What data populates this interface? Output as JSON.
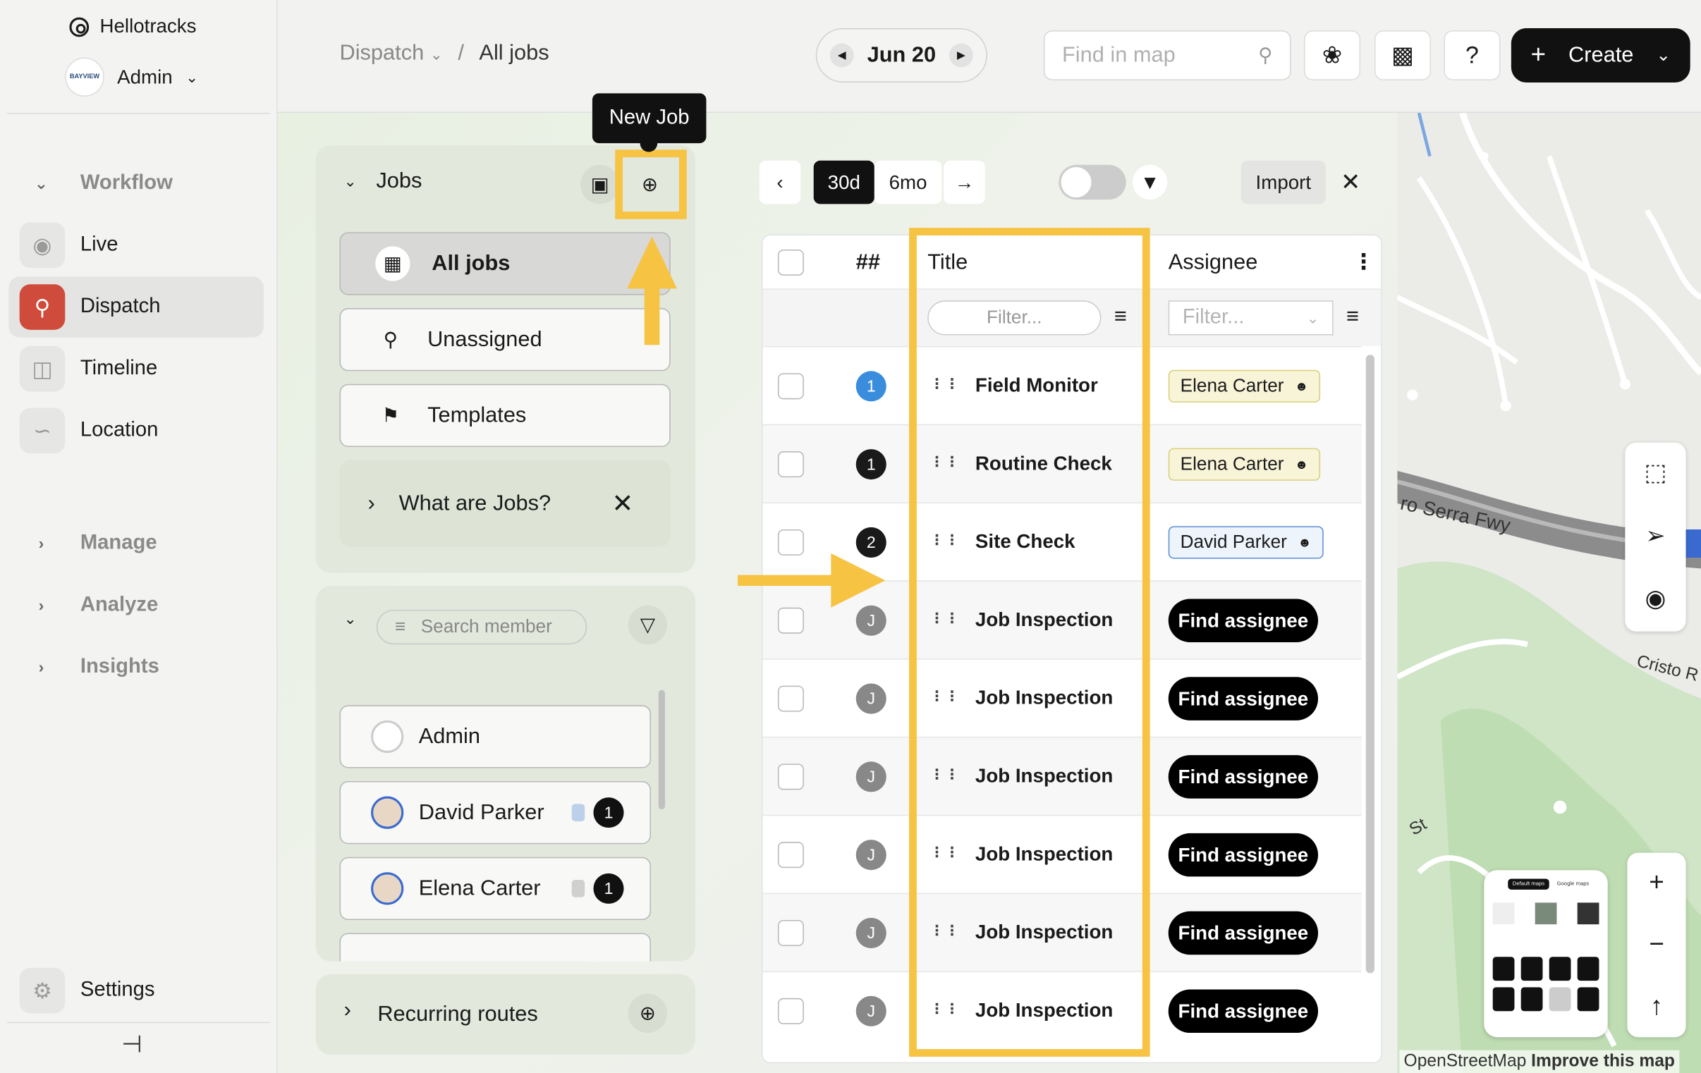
{
  "brand": {
    "name": "Hellotracks"
  },
  "org": {
    "name": "Admin",
    "badge": "BAYVIEW"
  },
  "sidebar": {
    "sections": [
      {
        "label": "Workflow",
        "expanded": true
      },
      {
        "label": "Manage",
        "expanded": false
      },
      {
        "label": "Analyze",
        "expanded": false
      },
      {
        "label": "Insights",
        "expanded": false
      }
    ],
    "items": [
      {
        "label": "Live",
        "icon": "globe-icon"
      },
      {
        "label": "Dispatch",
        "icon": "dispatch-icon",
        "active": true
      },
      {
        "label": "Timeline",
        "icon": "timeline-icon"
      },
      {
        "label": "Location",
        "icon": "route-icon"
      }
    ],
    "settings": "Settings"
  },
  "topbar": {
    "crumb_parent": "Dispatch",
    "crumb_sep": "/",
    "crumb_current": "All jobs",
    "date": "Jun 20",
    "search_placeholder": "Find in map",
    "help": "?",
    "create": "Create"
  },
  "jobs_panel": {
    "title": "Jobs",
    "tooltip": "New Job",
    "views": [
      {
        "label": "All jobs",
        "selected": true
      },
      {
        "label": "Unassigned"
      },
      {
        "label": "Templates"
      }
    ],
    "info": "What are Jobs?"
  },
  "members_panel": {
    "search_placeholder": "Search member",
    "members": [
      {
        "name": "Admin",
        "count": ""
      },
      {
        "name": "David Parker",
        "count": "1"
      },
      {
        "name": "Elena Carter",
        "count": "1"
      }
    ]
  },
  "routes_panel": {
    "title": "Recurring routes"
  },
  "toolbar": {
    "range_30d": "30d",
    "range_6mo": "6mo",
    "import": "Import"
  },
  "table": {
    "col_num": "##",
    "col_title": "Title",
    "col_assignee": "Assignee",
    "filter_placeholder": "Filter...",
    "rows": [
      {
        "num": "1",
        "num_color": "#3a8ddc",
        "title": "Field Monitor",
        "assignee": "Elena Carter",
        "tag_style": "yellow"
      },
      {
        "num": "1",
        "num_color": "#1a1a1a",
        "title": "Routine Check",
        "assignee": "Elena Carter",
        "tag_style": "yellow"
      },
      {
        "num": "2",
        "num_color": "#1a1a1a",
        "title": "Site Check",
        "assignee": "David Parker",
        "tag_style": "blue"
      },
      {
        "num": "J",
        "num_color": "#888888",
        "title": "Job Inspection",
        "assignee": "Find assignee",
        "tag_style": "button"
      },
      {
        "num": "J",
        "num_color": "#888888",
        "title": "Job Inspection",
        "assignee": "Find assignee",
        "tag_style": "button"
      },
      {
        "num": "J",
        "num_color": "#888888",
        "title": "Job Inspection",
        "assignee": "Find assignee",
        "tag_style": "button"
      },
      {
        "num": "J",
        "num_color": "#888888",
        "title": "Job Inspection",
        "assignee": "Find assignee",
        "tag_style": "button"
      },
      {
        "num": "J",
        "num_color": "#888888",
        "title": "Job Inspection",
        "assignee": "Find assignee",
        "tag_style": "button"
      },
      {
        "num": "J",
        "num_color": "#888888",
        "title": "Job Inspection",
        "assignee": "Find assignee",
        "tag_style": "button"
      }
    ]
  },
  "map": {
    "road_label": "ro Serra Fwy",
    "road_label_2": "Cristo R",
    "road_label_3": "St",
    "attribution": "OpenStreetMap",
    "improve": "Improve this map",
    "thumb_tab_1": "Default maps",
    "thumb_tab_2": "Google maps"
  },
  "colors": {
    "accent": "#f6c343",
    "dispatch": "#cf4b3b",
    "brand_dark": "#111111"
  }
}
